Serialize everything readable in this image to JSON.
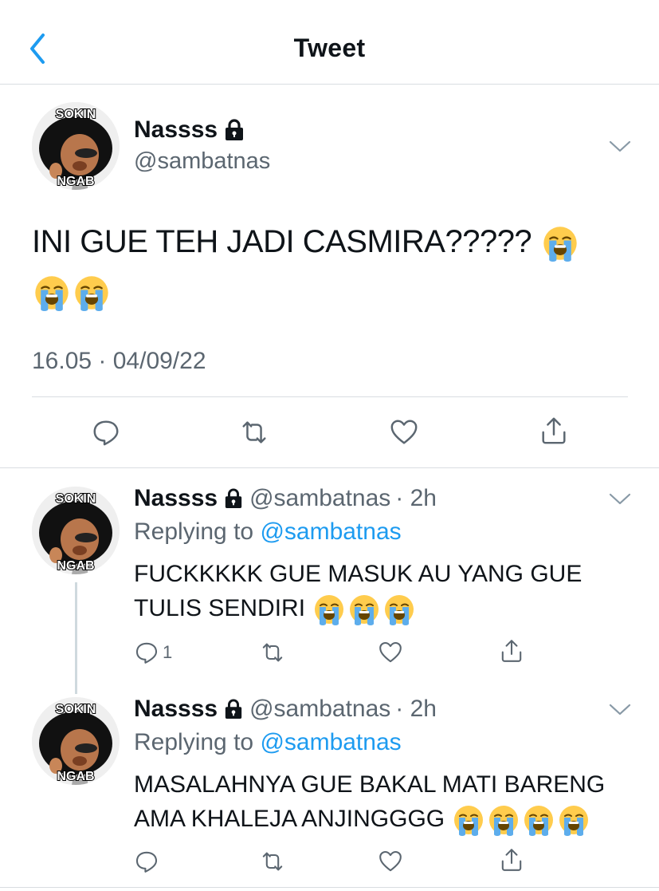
{
  "header": {
    "title": "Tweet"
  },
  "main_tweet": {
    "author_name": "Nassss",
    "handle": "@sambatnas",
    "text": "INI GUE TEH JADI CASMIRA?????",
    "emojis": [
      "loudly-crying-face",
      "loudly-crying-face",
      "loudly-crying-face"
    ],
    "timestamp": "16.05 · 04/09/22"
  },
  "avatar": {
    "top_text": "SOKIN",
    "bottom_text": "NGAB"
  },
  "replies": [
    {
      "author_name": "Nassss",
      "handle": "@sambatnas",
      "time": "· 2h",
      "replying_prefix": "Replying to",
      "replying_to": "@sambatnas",
      "line1": "FUCKKKKK GUE MASUK AU YANG GUE",
      "line2": "TULIS SENDIRI",
      "reply_count": "1"
    },
    {
      "author_name": "Nassss",
      "handle": "@sambatnas",
      "time": "· 2h",
      "replying_prefix": "Replying to",
      "replying_to": "@sambatnas",
      "line1": "MASALAHNYA GUE BAKAL MATI BARENG",
      "line2": "AMA KHALEJA ANJINGGGG",
      "reply_count": ""
    }
  ],
  "icons": {
    "back": "chevron-left-icon",
    "lock": "lock-icon",
    "more": "chevron-down-icon",
    "reply": "reply-icon",
    "retweet": "retweet-icon",
    "like": "heart-icon",
    "share": "share-icon"
  },
  "colors": {
    "accent": "#1d9bf0",
    "text": "#0f1419",
    "secondary": "#5b6670",
    "border": "#d9dde1"
  }
}
